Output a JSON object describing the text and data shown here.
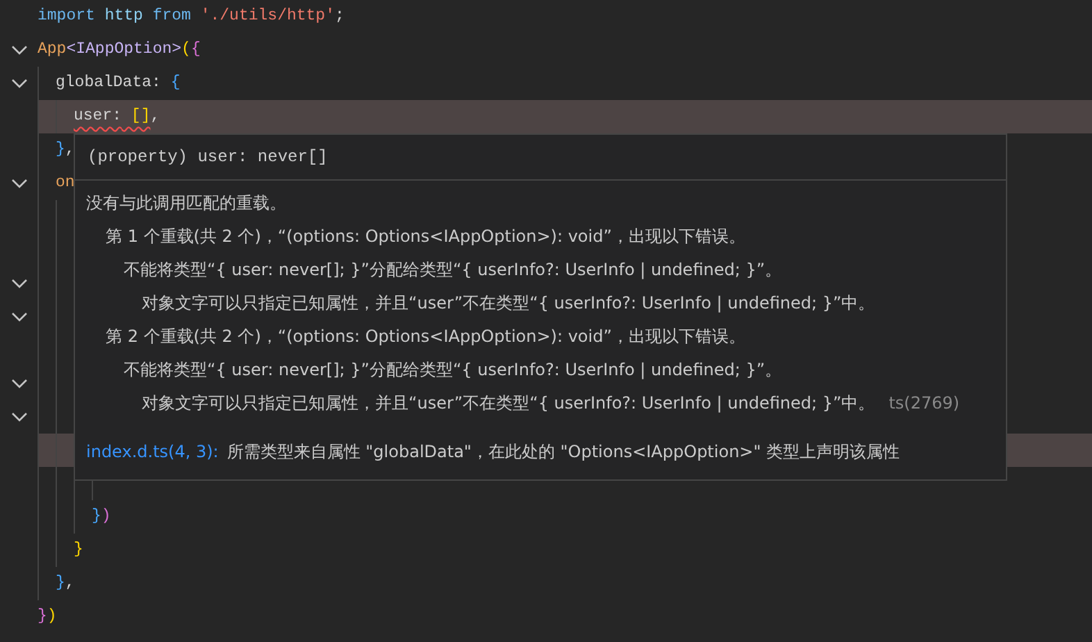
{
  "editor": {
    "lines": [
      {
        "fold": false,
        "highlighted": false,
        "tokens": [
          {
            "kind": "keyword",
            "text": "import"
          },
          {
            "kind": "variable",
            "text": " http"
          },
          {
            "kind": "keyword",
            "text": " from"
          },
          {
            "kind": "string",
            "text": " './utils/http'"
          },
          {
            "kind": "punct",
            "text": ";"
          }
        ]
      },
      {
        "fold": true,
        "highlighted": false,
        "tokens": [
          {
            "kind": "function",
            "text": "App"
          },
          {
            "kind": "type",
            "text": "<IAppOption>"
          },
          {
            "kind": "bracket1",
            "text": "("
          },
          {
            "kind": "bracket2",
            "text": "{"
          }
        ],
        "children": [
          {
            "fold": true,
            "highlighted": false,
            "tokens": [
              {
                "kind": "property",
                "text": "globalData:"
              },
              {
                "kind": "bracket3",
                "text": " {"
              }
            ],
            "children": [
              {
                "fold": false,
                "highlighted": true,
                "tokens": [
                  {
                    "kind": "property",
                    "text": "user:",
                    "error": true
                  },
                  {
                    "kind": "bracket1",
                    "text": " []",
                    "error": true
                  },
                  {
                    "kind": "punct",
                    "text": ",",
                    "error": false
                  }
                ]
              }
            ]
          },
          {
            "fold": false,
            "highlighted": false,
            "tokens": [
              {
                "kind": "bracket3",
                "text": "}"
              },
              {
                "kind": "punct",
                "text": ","
              }
            ]
          },
          {
            "fold": true,
            "highlighted": false,
            "tokens": [
              {
                "kind": "function",
                "text": "on"
              }
            ],
            "children": [
              {
                "fold": false,
                "highlighted": false
              },
              {
                "fold": false,
                "highlighted": false
              },
              {
                "fold": true,
                "highlighted": false
              },
              {
                "fold": true,
                "highlighted": false,
                "children": [
                  {
                    "fold": false,
                    "highlighted": false
                  },
                  {
                    "fold": true,
                    "highlighted": false
                  },
                  {
                    "fold": true,
                    "highlighted": false,
                    "children": [
                      {
                        "fold": false,
                        "highlighted": true
                      },
                      {
                        "fold": false,
                        "highlighted": false
                      }
                    ]
                  },
                  {
                    "fold": false,
                    "highlighted": false,
                    "tokens": [
                      {
                        "kind": "bracket3",
                        "text": "}"
                      },
                      {
                        "kind": "bracket2",
                        "text": ")"
                      }
                    ]
                  }
                ]
              },
              {
                "fold": false,
                "highlighted": false,
                "tokens": [
                  {
                    "kind": "bracket1",
                    "text": "}"
                  }
                ]
              }
            ]
          },
          {
            "fold": false,
            "highlighted": false,
            "tokens": [
              {
                "kind": "bracket3",
                "text": "}"
              },
              {
                "kind": "punct",
                "text": ","
              }
            ]
          }
        ]
      },
      {
        "fold": false,
        "highlighted": false,
        "tokens": [
          {
            "kind": "bracket2",
            "text": "}"
          },
          {
            "kind": "bracket1",
            "text": ")"
          }
        ]
      }
    ]
  },
  "hover": {
    "signature": "(property) user: never[]",
    "message": "没有与此调用匹配的重载。",
    "details": [
      {
        "text": "第 1 个重载(共 2 个)，“(options: Options<IAppOption>): void”，出现以下错误。",
        "children": [
          {
            "text": "不能将类型“{ user: never[]; }”分配给类型“{ userInfo?: UserInfo | undefined; }”。",
            "children": [
              {
                "text": "对象文字可以只指定已知属性，并且“user”不在类型“{ userInfo?: UserInfo | undefined; }”中。"
              }
            ]
          }
        ]
      },
      {
        "text": "第 2 个重载(共 2 个)，“(options: Options<IAppOption>): void”，出现以下错误。",
        "children": [
          {
            "text": "不能将类型“{ user: never[]; }”分配给类型“{ userInfo?: UserInfo | undefined; }”。",
            "children": [
              {
                "text": "对象文字可以只指定已知属性，并且“user”不在类型“{ userInfo?: UserInfo | undefined; }”中。",
                "code": "ts(2769)"
              }
            ]
          }
        ]
      }
    ],
    "related": {
      "link": "index.d.ts(4, 3):",
      "text": "所需类型来自属性 \"globalData\"，在此处的 \"Options<IAppOption>\" 类型上声明该属性"
    }
  }
}
